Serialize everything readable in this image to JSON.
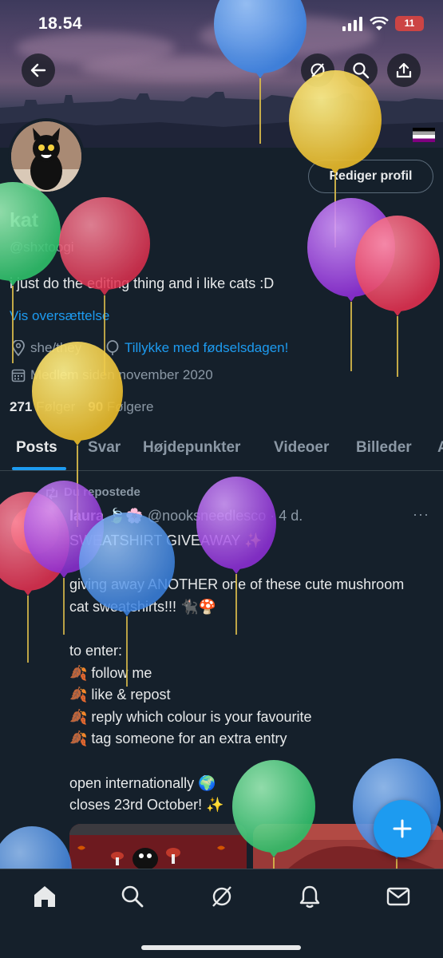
{
  "status_bar": {
    "time": "18.54",
    "battery": "11"
  },
  "header": {
    "back_icon": "arrow-left-icon",
    "grok_icon": "grok-icon",
    "search_icon": "search-icon",
    "share_icon": "share-icon"
  },
  "profile": {
    "edit_label": "Rediger profil",
    "name": "kat",
    "handle": "@shxtoogi",
    "bio": "i just do the editing thing and i like cats :D",
    "translate": "Vis oversættelse",
    "pronouns": "she/they",
    "birthday": "Tillykke med fødselsdagen!",
    "joined": "Medlem siden november 2020",
    "following_count": "271",
    "following_label": "Følger",
    "followers_count": "90",
    "followers_label": "Følgere"
  },
  "tabs": [
    "Posts",
    "Svar",
    "Højdepunkter",
    "Videoer",
    "Billeder",
    "A"
  ],
  "post": {
    "repost_label": "Du repostede",
    "author_name": "laura 🍃🌸",
    "author_handle": "@nooksneedlesco",
    "time": "· 4 d.",
    "more": "···",
    "text": "SWEATSHIRT GIVEAWAY ✨\n\ngiving away ANOTHER one of these cute mushroom cat sweatshirts!!! 🐈‍⬛🍄\n\nto enter:\n🍂 follow me\n🍂 like & repost\n🍂 reply which colour is your favourite\n🍂 tag someone for an extra entry\n\nopen internationally 🌍\ncloses 23rd October! ✨"
  },
  "colors": {
    "accent": "#1d9bf0",
    "background": "#15202b",
    "muted": "#8b98a5"
  },
  "nav": [
    "home-icon",
    "search-icon",
    "grok-icon",
    "notifications-icon",
    "messages-icon"
  ]
}
